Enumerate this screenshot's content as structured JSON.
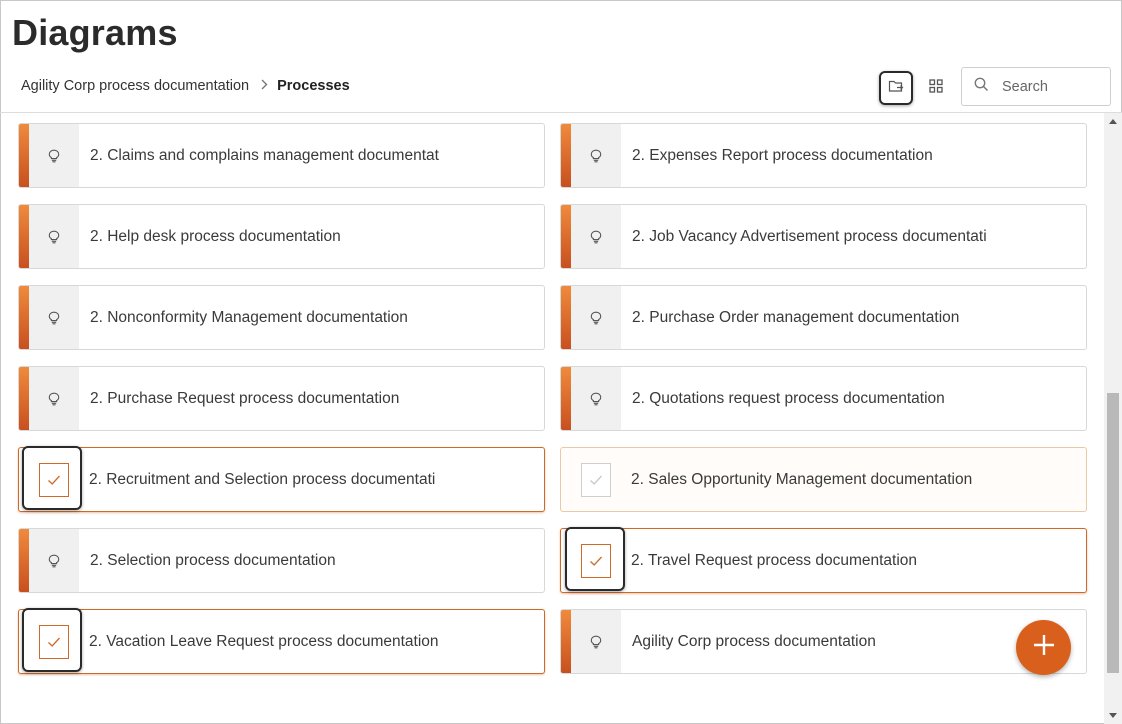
{
  "header": {
    "title": "Diagrams",
    "breadcrumb": {
      "parent": "Agility Corp process documentation",
      "current": "Processes"
    },
    "toolbar": {
      "folder_icon": "folder-arrow-icon",
      "grid_icon": "grid-view-icon"
    },
    "search": {
      "placeholder": "Search",
      "value": ""
    }
  },
  "colors": {
    "accent": "#e06a24",
    "fab": "#d9601c",
    "selected_border": "#cc6a2a"
  },
  "cards": [
    {
      "label": "2. Claims and complains management documentat",
      "state": "normal",
      "icon": "lightbulb-icon"
    },
    {
      "label": "2. Expenses Report process documentation",
      "state": "normal",
      "icon": "lightbulb-icon"
    },
    {
      "label": "2. Help desk process documentation",
      "state": "normal",
      "icon": "lightbulb-icon"
    },
    {
      "label": "2. Job Vacancy Advertisement process documentati",
      "state": "normal",
      "icon": "lightbulb-icon"
    },
    {
      "label": "2. Nonconformity Management documentation",
      "state": "normal",
      "icon": "lightbulb-icon"
    },
    {
      "label": "2. Purchase Order management documentation",
      "state": "normal",
      "icon": "lightbulb-icon"
    },
    {
      "label": "2. Purchase Request process documentation",
      "state": "normal",
      "icon": "lightbulb-icon"
    },
    {
      "label": "2. Quotations request process documentation",
      "state": "normal",
      "icon": "lightbulb-icon"
    },
    {
      "label": "2. Recruitment and Selection process documentati",
      "state": "selected",
      "icon": "checkbox-checked-icon"
    },
    {
      "label": "2. Sales Opportunity Management documentation",
      "state": "hover",
      "icon": "checkbox-unchecked-icon"
    },
    {
      "label": "2. Selection process documentation",
      "state": "normal",
      "icon": "lightbulb-icon"
    },
    {
      "label": "2. Travel Request process documentation",
      "state": "selected",
      "icon": "checkbox-checked-icon"
    },
    {
      "label": "2. Vacation Leave Request process documentation",
      "state": "selected",
      "icon": "checkbox-checked-icon"
    },
    {
      "label": "Agility Corp process documentation",
      "state": "normal",
      "icon": "lightbulb-icon"
    }
  ],
  "fab": {
    "icon": "plus-icon"
  }
}
